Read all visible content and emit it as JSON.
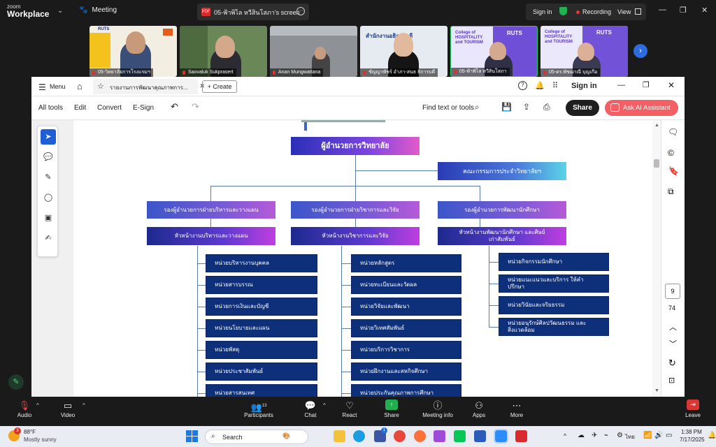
{
  "zoom_top": {
    "logo_small": "zoom",
    "logo_big": "Workplace",
    "meeting_label": "Meeting",
    "share_tab_title": "05-ฟ้าพิไล หวีสินโสภา's screen",
    "pdf_badge": "PDF",
    "sign_in": "Sign in",
    "recording": "Recording",
    "view": "View"
  },
  "participants": [
    {
      "name": "05-วิทยาลัยการโรงแรมฯ",
      "bg": "#f4efe4"
    },
    {
      "name": "Saovaluk Sukprasert",
      "bg": "#6f8b5b"
    },
    {
      "name": "Anan Mungwattana",
      "bg": "#8b8f95"
    },
    {
      "name": "ชัญญาพัชร์ อำภา-สนธ ธิการบดี",
      "bg": "#dfe6f0"
    },
    {
      "name": "05-ฟ้าพิไล หวีสินโสภา",
      "bg": "#a39ad8"
    },
    {
      "name": "05-ดร.พัชฌาณี บุญเกือ",
      "bg": "#b3a4e6"
    }
  ],
  "thumb_texts": {
    "logo": "RUTS",
    "college_line1": "College of",
    "college_line2": "HOSPITALITY",
    "college_line3": "and TOURISM",
    "welcome": "Welcome",
    "slide_title": "สำนักงานอธิการบดี"
  },
  "acrobat": {
    "menu": "Menu",
    "doc_tab": "รายงานการพัฒนาคุณภาพการ...",
    "create": "Create",
    "sign_in": "Sign in",
    "tools": [
      "All tools",
      "Edit",
      "Convert",
      "E-Sign"
    ],
    "find": "Find text or tools",
    "share": "Share",
    "ai_assistant": "Ask AI Assistant",
    "page_number": "9",
    "page_total": "74"
  },
  "org_chart": {
    "head": "ผู้อำนวยการวิทยาลัย",
    "committee": "คณะกรรมการประจำวิทยาลัยฯ",
    "columns": [
      {
        "deputy": "รองผู้อำนวยการฝ่ายบริหารและวางแผน",
        "head": "หัวหน้างานบริหารและวางแผน",
        "units": [
          "หน่วยบริหารงานบุคคล",
          "หน่วยสารบรรณ",
          "หน่วยการเงินและบัญชี",
          "หน่วยนโยบายและแผน",
          "หน่วยพัสดุ",
          "หน่วยประชาสัมพันธ์",
          "หน่วยสารสนเทศ"
        ]
      },
      {
        "deputy": "รองผู้อำนวยการฝ่ายวิชาการและวิจัย",
        "head": "หัวหน้างานวิชาการและวิจัย",
        "units": [
          "หน่วยหลักสูตร",
          "หน่วยทะเบียนและวัดผล",
          "หน่วยวิจัยและพัฒนา",
          "หน่วยวิเทศสัมพันธ์",
          "หน่วยบริการวิชาการ",
          "หน่วยฝึกงานและสหกิจศึกษา",
          "หน่วยประกันคุณภาพการศึกษา"
        ]
      },
      {
        "deputy": "รองผู้อำนวยการพัฒนานักศึกษา",
        "head": "หัวหน้างานพัฒนานักศึกษา และศิษย์เก่าสัมพันธ์",
        "units": [
          "หน่วยกิจกรรมนักศึกษา",
          "หน่วยแนะแนวและบริการ ให้คำปรึกษา",
          "หน่วยวินัยและจริยธรรม",
          "หน่วยอนุรักษ์ศิลปวัฒนธรรม และสิ่งแวดล้อม"
        ]
      }
    ]
  },
  "zoom_bottom": {
    "audio": "Audio",
    "video": "Video",
    "participants": "Participants",
    "participants_count": "13",
    "chat": "Chat",
    "react": "React",
    "share": "Share",
    "meeting_info": "Meeting info",
    "apps": "Apps",
    "more": "More",
    "leave": "Leave"
  },
  "taskbar": {
    "weather_temp": "88°F",
    "weather_desc": "Mostly sunny",
    "weather_badge": "3",
    "search": "Search",
    "teams_badge": "1",
    "lang": "ไทย",
    "time": "1:38 PM",
    "date": "7/17/2025"
  }
}
